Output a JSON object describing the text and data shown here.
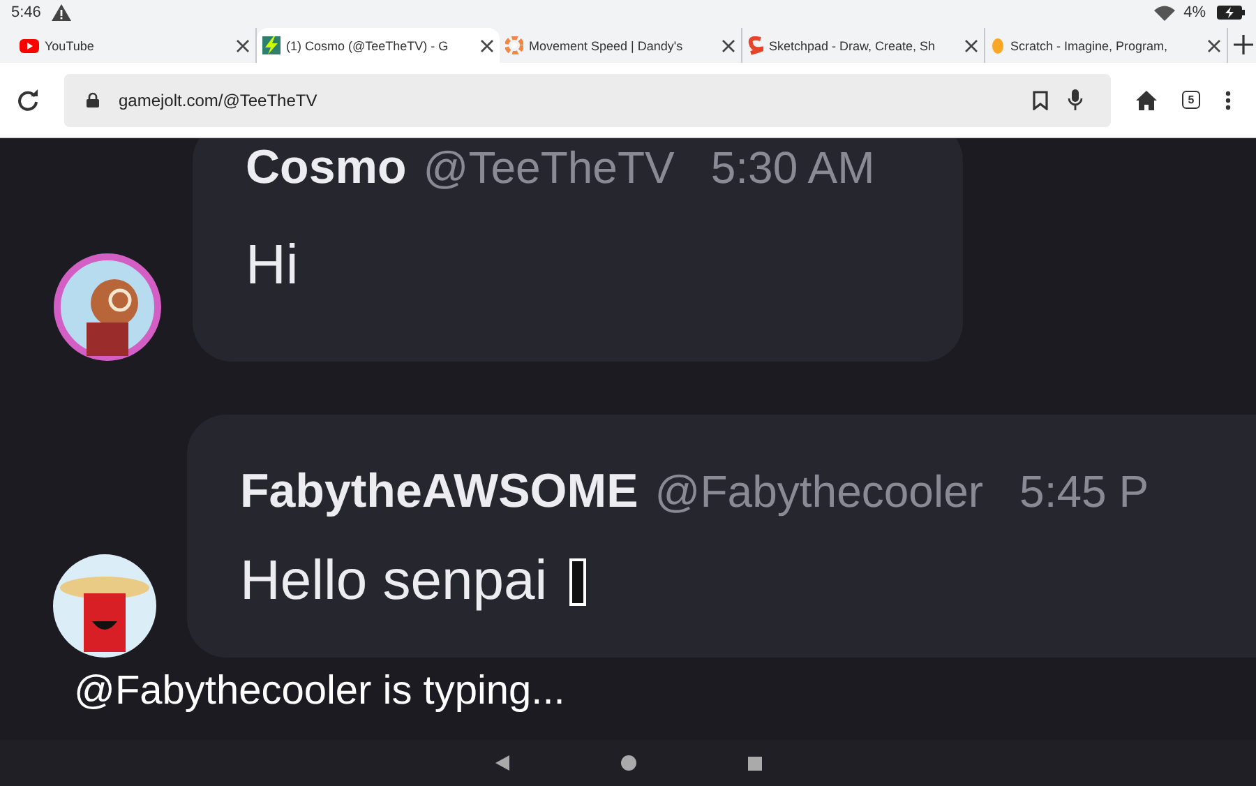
{
  "status_bar": {
    "time": "5:46",
    "battery": "4%"
  },
  "tabs": [
    {
      "title": "YouTube",
      "selected": false
    },
    {
      "title": "(1) Cosmo (@TeeTheTV) - G",
      "selected": true
    },
    {
      "title": "Movement Speed | Dandy's",
      "selected": false
    },
    {
      "title": "Sketchpad - Draw, Create, Sh",
      "selected": false
    },
    {
      "title": "Scratch - Imagine, Program,",
      "selected": false
    }
  ],
  "toolbar": {
    "url": "gamejolt.com/@TeeTheTV",
    "tab_count": "5"
  },
  "messages": [
    {
      "author": "Cosmo",
      "handle": "@TeeTheTV",
      "time": "5:30 AM",
      "text": "Hi",
      "missing_glyph": false
    },
    {
      "author": "FabytheAWSOME",
      "handle": "@Fabythecooler",
      "time": "5:45 P",
      "text": "Hello senpai",
      "missing_glyph": true
    }
  ],
  "typing": "@Fabythecooler is typing..."
}
